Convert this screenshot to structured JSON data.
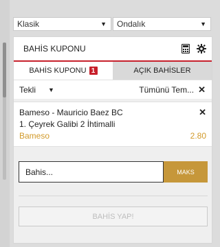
{
  "selects": {
    "odds_type": "Klasik",
    "odds_format": "Ondalık"
  },
  "betslip": {
    "title": "BAHİS KUPONU",
    "icons": [
      "calculator-icon",
      "gear-icon"
    ],
    "tabs": [
      {
        "label": "BAHİS KUPONU",
        "badge": "1",
        "active": true
      },
      {
        "label": "AÇIK BAHİSLER",
        "active": false
      }
    ],
    "mode": "Tekli",
    "clear_all": "Tümünü Tem...",
    "selection": {
      "event": "Bameso - Mauricio Baez BC",
      "market": "1. Çeyrek Galibi 2 İhtimalli",
      "pick": "Bameso",
      "odds": "2.80"
    },
    "stake_placeholder": "Bahis...",
    "max_label": "MAKS",
    "place_bet_label": "BAHİS YAP!"
  },
  "colors": {
    "accent_red": "#c7202b",
    "gold": "#c6973a",
    "pick_gold": "#d29a2a"
  }
}
